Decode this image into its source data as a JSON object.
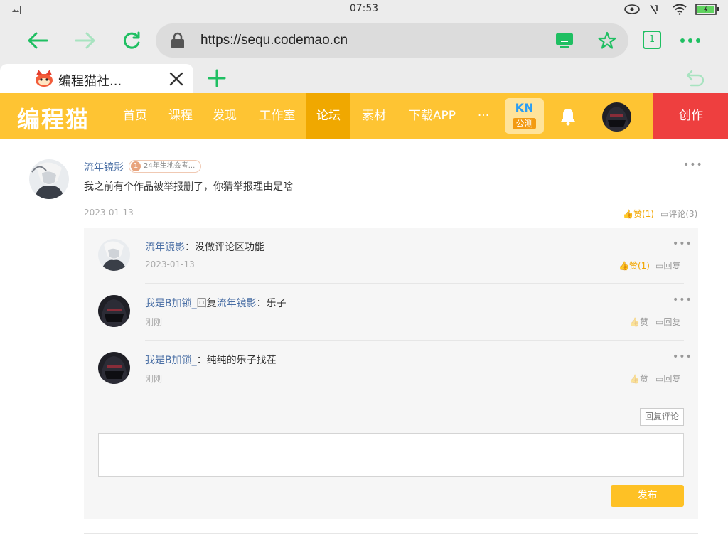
{
  "status_bar": {
    "time": "07:53"
  },
  "browser": {
    "url": "https://sequ.codemao.cn",
    "tab_title": "编程猫社...",
    "tab_count": "1"
  },
  "site_nav": {
    "logo": "编程猫",
    "items": [
      "首页",
      "课程",
      "发现",
      "工作室",
      "论坛",
      "素材",
      "下载APP"
    ],
    "active_item": "论坛",
    "more": "···",
    "kn_top": "KN",
    "kn_bottom": "公测",
    "create": "创作"
  },
  "post": {
    "author": "流年镜影",
    "badge": "24年生地会考...",
    "badge_level": "1",
    "text": "我之前有个作品被举报删了，你猜举报理由是啥",
    "date": "2023-01-13",
    "like_label": "赞(1)",
    "comment_label": "评论(3)"
  },
  "replies": [
    {
      "author": "流年镜影",
      "reply_word": "",
      "target": "",
      "sep": "：",
      "text": "没做评论区功能",
      "time": "2023-01-13",
      "like": "赞(1)",
      "reply": "回复",
      "liked": true
    },
    {
      "author": "我是B加锁_",
      "reply_word": "回复",
      "target": "流年镜影",
      "sep": "：",
      "text": "乐子",
      "time": "刚刚",
      "like": "赞",
      "reply": "回复",
      "liked": false
    },
    {
      "author": "我是B加锁_",
      "reply_word": "",
      "target": "",
      "sep": "：",
      "text": "纯纯的乐子找茬",
      "time": "刚刚",
      "like": "赞",
      "reply": "回复",
      "liked": false
    }
  ],
  "composer": {
    "reply_comment_button": "回复评论",
    "publish_button": "发布",
    "placeholder": ""
  },
  "colors": {
    "brand_yellow": "#fec433",
    "active_yellow": "#f0a800",
    "create_red": "#ee3f3f",
    "browser_green": "#1fbf62",
    "link_blue": "#4a6fa5"
  }
}
